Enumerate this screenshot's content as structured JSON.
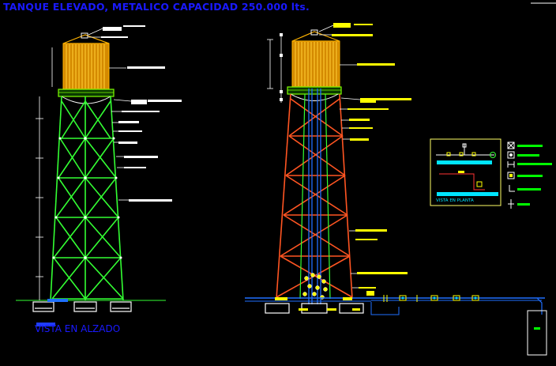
{
  "drawing": {
    "title": "TANQUE ELEVADO, METALICO CAPACIDAD 250.000 lts.",
    "elevation_caption": "VISTA EN ALZADO",
    "plan_caption": "VISTA EN PLANTA"
  },
  "colors": {
    "background": "#000000",
    "title": "#1a1aff",
    "tower_left": "#33ff33",
    "tower_right": "#ff5522",
    "tank": "#ffb300",
    "tank_band": "#7fff00",
    "label_bar_white": "#ffffff",
    "label_bar_yellow": "#ffff00",
    "label_bar_green": "#00ff00",
    "pipe": "#1f6fff",
    "plan_frame": "#ffff66",
    "plan_fill": "#00e5ff"
  },
  "icons": [
    "gate-valve-icon",
    "check-valve-icon",
    "flange-icon",
    "meter-icon",
    "elbow-icon",
    "tee-icon"
  ]
}
